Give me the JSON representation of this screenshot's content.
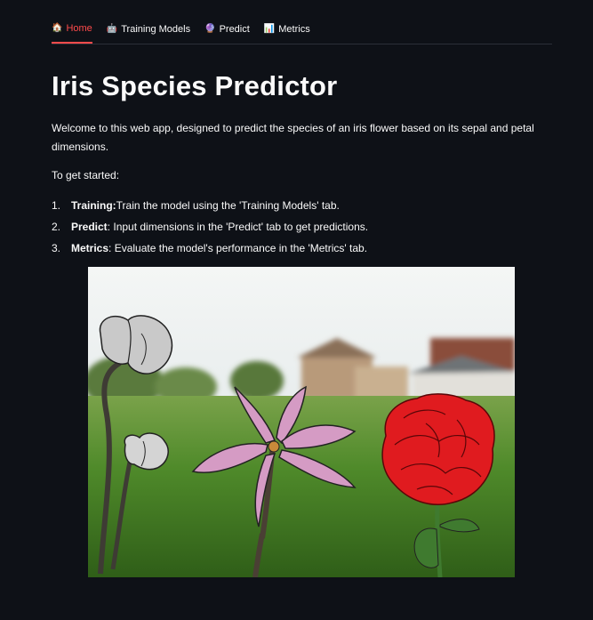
{
  "tabs": [
    {
      "icon": "🏠",
      "label": "Home",
      "active": true
    },
    {
      "icon": "🤖",
      "label": "Training Models",
      "active": false
    },
    {
      "icon": "🔮",
      "label": "Predict",
      "active": false
    },
    {
      "icon": "📊",
      "label": "Metrics",
      "active": false
    }
  ],
  "accent_color": "#ff4b4b",
  "page": {
    "title": "Iris Species Predictor",
    "intro": "Welcome to this web app, designed to predict the species of an iris flower based on its sepal and petal dimensions.",
    "getting_started": "To get started:",
    "steps": [
      {
        "num": "1.",
        "term": "Training:",
        "text": " Train the model using the 'Training Models' tab."
      },
      {
        "num": "2.",
        "term": "Predict",
        "text": ": Input dimensions in the 'Predict' tab to get predictions."
      },
      {
        "num": "3.",
        "term": "Metrics",
        "text": ": Evaluate the model's performance in the 'Metrics' tab."
      }
    ]
  },
  "hero_image": {
    "subject": "illustrated-flowers-on-lawn"
  }
}
